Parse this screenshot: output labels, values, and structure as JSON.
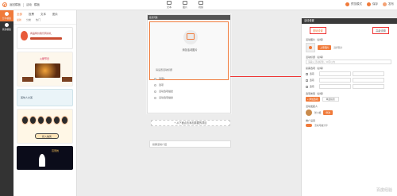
{
  "topbar": {
    "back_label": "返回模板",
    "title_parts": [
      "活动",
      "模板"
    ],
    "tools": [
      "文本",
      "图片",
      "视频"
    ],
    "preview_label": "预览模式",
    "save_label": "保存",
    "publish_label": "发布"
  },
  "leftnav": {
    "items": [
      "分享模板",
      "我的模板"
    ]
  },
  "templates": {
    "tabs": [
      "全部",
      "投票",
      "文本",
      "图片"
    ],
    "subtabs": [
      "最新",
      "分类",
      "热门"
    ],
    "cards": [
      {
        "text": "商品特价我们有好礼"
      },
      {
        "text": "火锅节日"
      },
      {
        "text": "美味人文美"
      },
      {
        "button": "投入抽奖"
      },
      {
        "text": "芭蕾舞"
      }
    ]
  },
  "canvas": {
    "header": "投票问题",
    "image_placeholder": "添加活动图片",
    "question": "请设置活动标题",
    "options": [
      "选项1",
      "选项",
      "活动选项描述",
      "活动选项描述"
    ],
    "add_button": "+ 从下面点击添加需要的项目",
    "intro_placeholder": "投票活动介绍"
  },
  "panel": {
    "header": "活动设置",
    "tabs": [
      "基础设置",
      "高级设置"
    ],
    "cover_label": "活动图片（必填）",
    "upload_btn": "上传图片",
    "pick_link": "选择图片",
    "title_label": "活动标题（必填）",
    "title_placeholder": "请输入活动标题，30字以内",
    "options_label": "投票选项（必填）",
    "option_names": [
      "选项",
      "选项",
      "选项"
    ],
    "type_label": "选项类型（必填）",
    "add_option": "+ 添加选项",
    "select_value": "单选投票",
    "sponsor_label": "活动发起人",
    "sponsor_name": "张小姐",
    "sponsor_btn": "修改",
    "share_label": "推广设置",
    "share_text": "活动可被分享"
  },
  "watermark": "百度经验"
}
